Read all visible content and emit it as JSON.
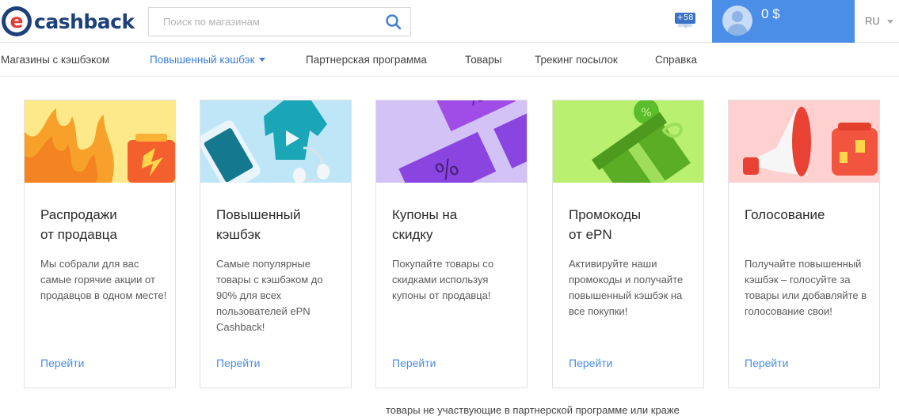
{
  "brand": {
    "logo_letter": "e",
    "logo_text": "cashback"
  },
  "search": {
    "placeholder": "Поиск по магазинам"
  },
  "notifications": {
    "count": "+58"
  },
  "user": {
    "balance": "0 $"
  },
  "language": {
    "current": "RU"
  },
  "nav": {
    "items": [
      {
        "label": "Магазины с кэшбэком"
      },
      {
        "label": "Повышенный кэшбэк"
      },
      {
        "label": "Партнерская программа"
      },
      {
        "label": "Товары"
      },
      {
        "label": "Трекинг посылок"
      },
      {
        "label": "Справка"
      }
    ]
  },
  "cards": [
    {
      "title_line1": "Распродажи",
      "title_line2": "от продавца",
      "description": "Мы собрали для вас самые горячие акции от продавцов в одном месте!",
      "link": "Перейти"
    },
    {
      "title_line1": "Повышенный",
      "title_line2": "кэшбэк",
      "description": "Самые популярные товары с кэшбэком до 90% для всех пользователей ePN Cashback!",
      "link": "Перейти"
    },
    {
      "title_line1": "Купоны на",
      "title_line2": "скидку",
      "description": "Покупайте товары со скидками используя купоны от продавца!",
      "link": "Перейти"
    },
    {
      "title_line1": "Промокоды",
      "title_line2": "от ePN",
      "description": "Активируйте наши промокоды и получайте повышенный кэшбэк на все покупки!",
      "link": "Перейти"
    },
    {
      "title_line1": "Голосование",
      "title_line2": "",
      "description": "Получайте повышенный кэшбэк – голосуйте за товары или добавляйте в голосование свои!",
      "link": "Перейти"
    }
  ],
  "footer": {
    "partial_text": "товары не участвующие в партнерской программе или краже"
  },
  "colors": {
    "accent": "#4a8ee8",
    "link": "#4a8ee0",
    "brand_navy": "#1d3f7a",
    "brand_red": "#e53935"
  }
}
